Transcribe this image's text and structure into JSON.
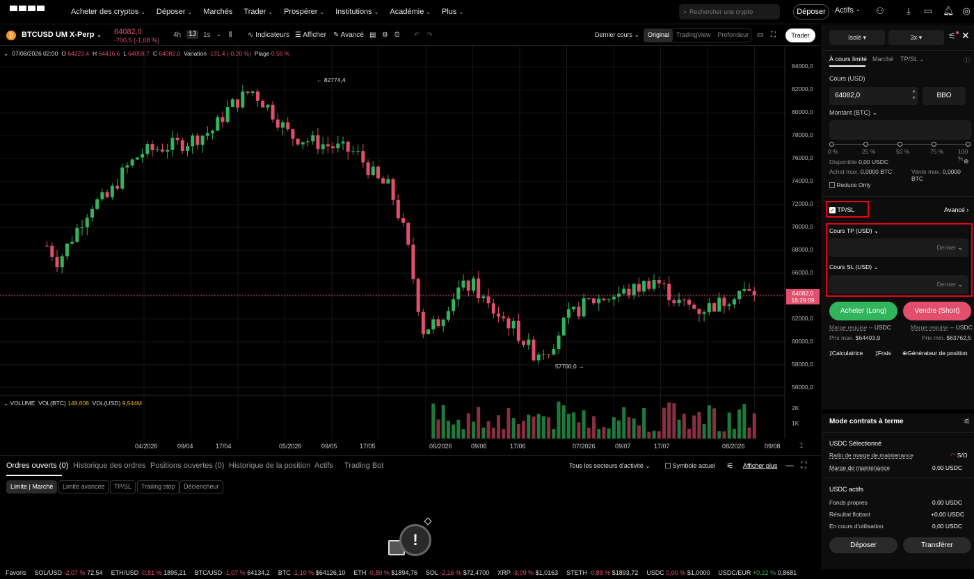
{
  "nav": {
    "items": [
      "Acheter des cryptos",
      "Déposer",
      "Marchés",
      "Trader",
      "Prospérer",
      "Institutions",
      "Académie",
      "Plus"
    ],
    "search_placeholder": "Rechercher une crypto",
    "deposit_label": "Déposer",
    "assets_label": "Actifs"
  },
  "ticker": {
    "pair": "BTCUSD UM X-Perp",
    "price": "64082,0",
    "change": "-700,5 (-1,08 %)",
    "timeframes": [
      "4h",
      "1J",
      "1s"
    ],
    "selected_timeframe": "1J",
    "indicators_label": "Indicateurs",
    "display_label": "Afficher",
    "advanced_label": "Avancé",
    "last_price_label": "Dernier cours",
    "view_tabs": [
      "Original",
      "TradingView",
      "Profondeur"
    ],
    "trader_label": "Trader"
  },
  "chart_info": {
    "date": "07/08/2026 02:00",
    "o_label": "O",
    "o": "64223,4",
    "h_label": "H",
    "h": "64416,6",
    "l_label": "L",
    "l": "64058,7",
    "c_label": "C",
    "c": "64082,0",
    "variation_label": "Variation",
    "variation": "-131,4 (-0,20 %)",
    "range_label": "Plage",
    "range": "0,56 %",
    "high_annot": "82774,4",
    "low_annot": "57700,0",
    "last_price_tag": "64082,0",
    "countdown": "18:29:09",
    "volume_label": "VOLUME",
    "vol_btc_label": "VOL(BTC)",
    "vol_btc": "148,608",
    "vol_usd_label": "VOL(USD)",
    "vol_usd": "9,544M",
    "vol_axis": [
      "2K",
      "1K"
    ]
  },
  "chart_data": {
    "type": "candlestick",
    "y_axis_ticks": [
      "84000,0",
      "82000,0",
      "80000,0",
      "78000,0",
      "76000,0",
      "74000,0",
      "72000,0",
      "70000,0",
      "68000,0",
      "66000,0",
      "64000,0",
      "62000,0",
      "60000,0",
      "58000,0",
      "56000,0"
    ],
    "ylim": [
      55500,
      85000
    ],
    "x_axis_ticks": [
      "04/2026",
      "09/04",
      "17/04",
      "05/2026",
      "09/05",
      "17/05",
      "06/2026",
      "09/06",
      "17/06",
      "07/2026",
      "09/07",
      "17/07",
      "08/2026",
      "09/08"
    ],
    "close_trend": [
      {
        "x": "2026-04-01",
        "y": 68400
      },
      {
        "x": "2026-04-03",
        "y": 67000
      },
      {
        "x": "2026-04-06",
        "y": 69500
      },
      {
        "x": "2026-04-09",
        "y": 72000
      },
      {
        "x": "2026-04-12",
        "y": 72600
      },
      {
        "x": "2026-04-15",
        "y": 75000
      },
      {
        "x": "2026-04-18",
        "y": 76500
      },
      {
        "x": "2026-04-22",
        "y": 77000
      },
      {
        "x": "2026-04-26",
        "y": 77400
      },
      {
        "x": "2026-05-01",
        "y": 78500
      },
      {
        "x": "2026-05-04",
        "y": 80500
      },
      {
        "x": "2026-05-08",
        "y": 82000
      },
      {
        "x": "2026-05-11",
        "y": 80500
      },
      {
        "x": "2026-05-15",
        "y": 78000
      },
      {
        "x": "2026-05-19",
        "y": 77500
      },
      {
        "x": "2026-05-23",
        "y": 77000
      },
      {
        "x": "2026-05-27",
        "y": 76500
      },
      {
        "x": "2026-05-31",
        "y": 74000
      },
      {
        "x": "2026-06-02",
        "y": 73500
      },
      {
        "x": "2026-06-05",
        "y": 69000
      },
      {
        "x": "2026-06-08",
        "y": 61000
      },
      {
        "x": "2026-06-11",
        "y": 62000
      },
      {
        "x": "2026-06-14",
        "y": 64500
      },
      {
        "x": "2026-06-17",
        "y": 65000
      },
      {
        "x": "2026-06-20",
        "y": 63000
      },
      {
        "x": "2026-06-24",
        "y": 61500
      },
      {
        "x": "2026-06-28",
        "y": 59000
      },
      {
        "x": "2026-07-01",
        "y": 59500
      },
      {
        "x": "2026-07-04",
        "y": 62000
      },
      {
        "x": "2026-07-08",
        "y": 63500
      },
      {
        "x": "2026-07-12",
        "y": 64000
      },
      {
        "x": "2026-07-16",
        "y": 64500
      },
      {
        "x": "2026-07-20",
        "y": 65500
      },
      {
        "x": "2026-07-24",
        "y": 63500
      },
      {
        "x": "2026-07-28",
        "y": 62800
      },
      {
        "x": "2026-08-01",
        "y": 63400
      },
      {
        "x": "2026-08-04",
        "y": 64500
      },
      {
        "x": "2026-08-07",
        "y": 64082
      }
    ]
  },
  "bottom": {
    "tabs": [
      "Ordres ouverts (0)",
      "Historique des ordres",
      "Positions ouvertes (0)",
      "Historique de la position",
      "Actifs",
      "Trading Bot"
    ],
    "sector_filter": "Tous les secteurs d'activité",
    "current_symbol_label": "Symbole actuel",
    "show_more_label": "Afficher plus",
    "chips": [
      "Limite | Marché",
      "Limite avancée",
      "TP/SL",
      "Trailing stop",
      "Déclencheur"
    ]
  },
  "footer": {
    "favorites_label": "Favoris",
    "items": [
      {
        "sym": "SOL/USD",
        "chg": "-2,07 %",
        "price": "72,54"
      },
      {
        "sym": "ETH/USD",
        "chg": "-0,81 %",
        "price": "1895,21"
      },
      {
        "sym": "BTC/USD",
        "chg": "-1,07 %",
        "price": "64134,2"
      },
      {
        "sym": "BTC",
        "chg": "-1,10 %",
        "price": "$64126,10"
      },
      {
        "sym": "ETH",
        "chg": "-0,80 %",
        "price": "$1894,76"
      },
      {
        "sym": "SOL",
        "chg": "-2,16 %",
        "price": "$72,4700"
      },
      {
        "sym": "XRP",
        "chg": "-3,09 %",
        "price": "$1,0163"
      },
      {
        "sym": "STETH",
        "chg": "-0,88 %",
        "price": "$1893,72"
      },
      {
        "sym": "USDC",
        "chg": "0,00 %",
        "price": "$1,0000"
      },
      {
        "sym": "USDC/EUR",
        "chg": "+0,22 %",
        "price": "0,8681"
      }
    ]
  },
  "panel": {
    "margin_mode": "Isolé",
    "leverage": "3x",
    "order_types": [
      "À cours limité",
      "Marché",
      "TP/SL"
    ],
    "price_label": "Cours (USD)",
    "price_value": "64082,0",
    "bbo_label": "BBO",
    "amount_label": "Montant (BTC)",
    "slider_marks": [
      "0 %",
      "25 %",
      "50 %",
      "75 %",
      "100 %"
    ],
    "available_label": "Disponible",
    "available_value": "0,00 USDC",
    "max_buy_label": "Achat max.",
    "max_buy_value": "0,0000 BTC",
    "max_sell_label": "Vente max.",
    "max_sell_value": "0,0000 BTC",
    "reduce_only_label": "Reduce Only",
    "tpsl_label": "TP/SL",
    "advanced_label": "Avancé",
    "tp_label": "Cours TP (USD)",
    "sl_label": "Cours SL (USD)",
    "last_label": "Dernier",
    "buy_label": "Acheter (Long)",
    "sell_label": "Vendre (Short)",
    "margin_req_label": "Marge requise",
    "margin_req_buy": "-- USDC",
    "margin_req_sell": "-- USDC",
    "max_price_label": "Prix max.",
    "max_price": "$64403,9",
    "min_price_label": "Prix min.",
    "min_price": "$63762,5",
    "calc_label": "Calculatrice",
    "fees_label": "Frais",
    "position_builder_label": "Générateur de position",
    "contract_mode_title": "Mode contrats à terme",
    "usdc_selected": "USDC Sélectionné",
    "maint_ratio_label": "Ratio de marge de maintenance",
    "maint_ratio_value": "S/O",
    "maint_margin_label": "Marge de maintenance",
    "maint_margin_value": "0,00 USDC",
    "usdc_assets_title": "USDC actifs",
    "equity_label": "Fonds propres",
    "equity_value": "0,00 USDC",
    "float_label": "Résultat flottant",
    "float_value": "+0,00 USDC",
    "in_use_label": "En cours d'utilisation",
    "in_use_value": "0,00 USDC",
    "deposit_btn": "Déposer",
    "transfer_btn": "Transférer"
  },
  "colors": {
    "up": "#31b45b",
    "down": "#e24f6c",
    "highlight": "#e60012"
  }
}
